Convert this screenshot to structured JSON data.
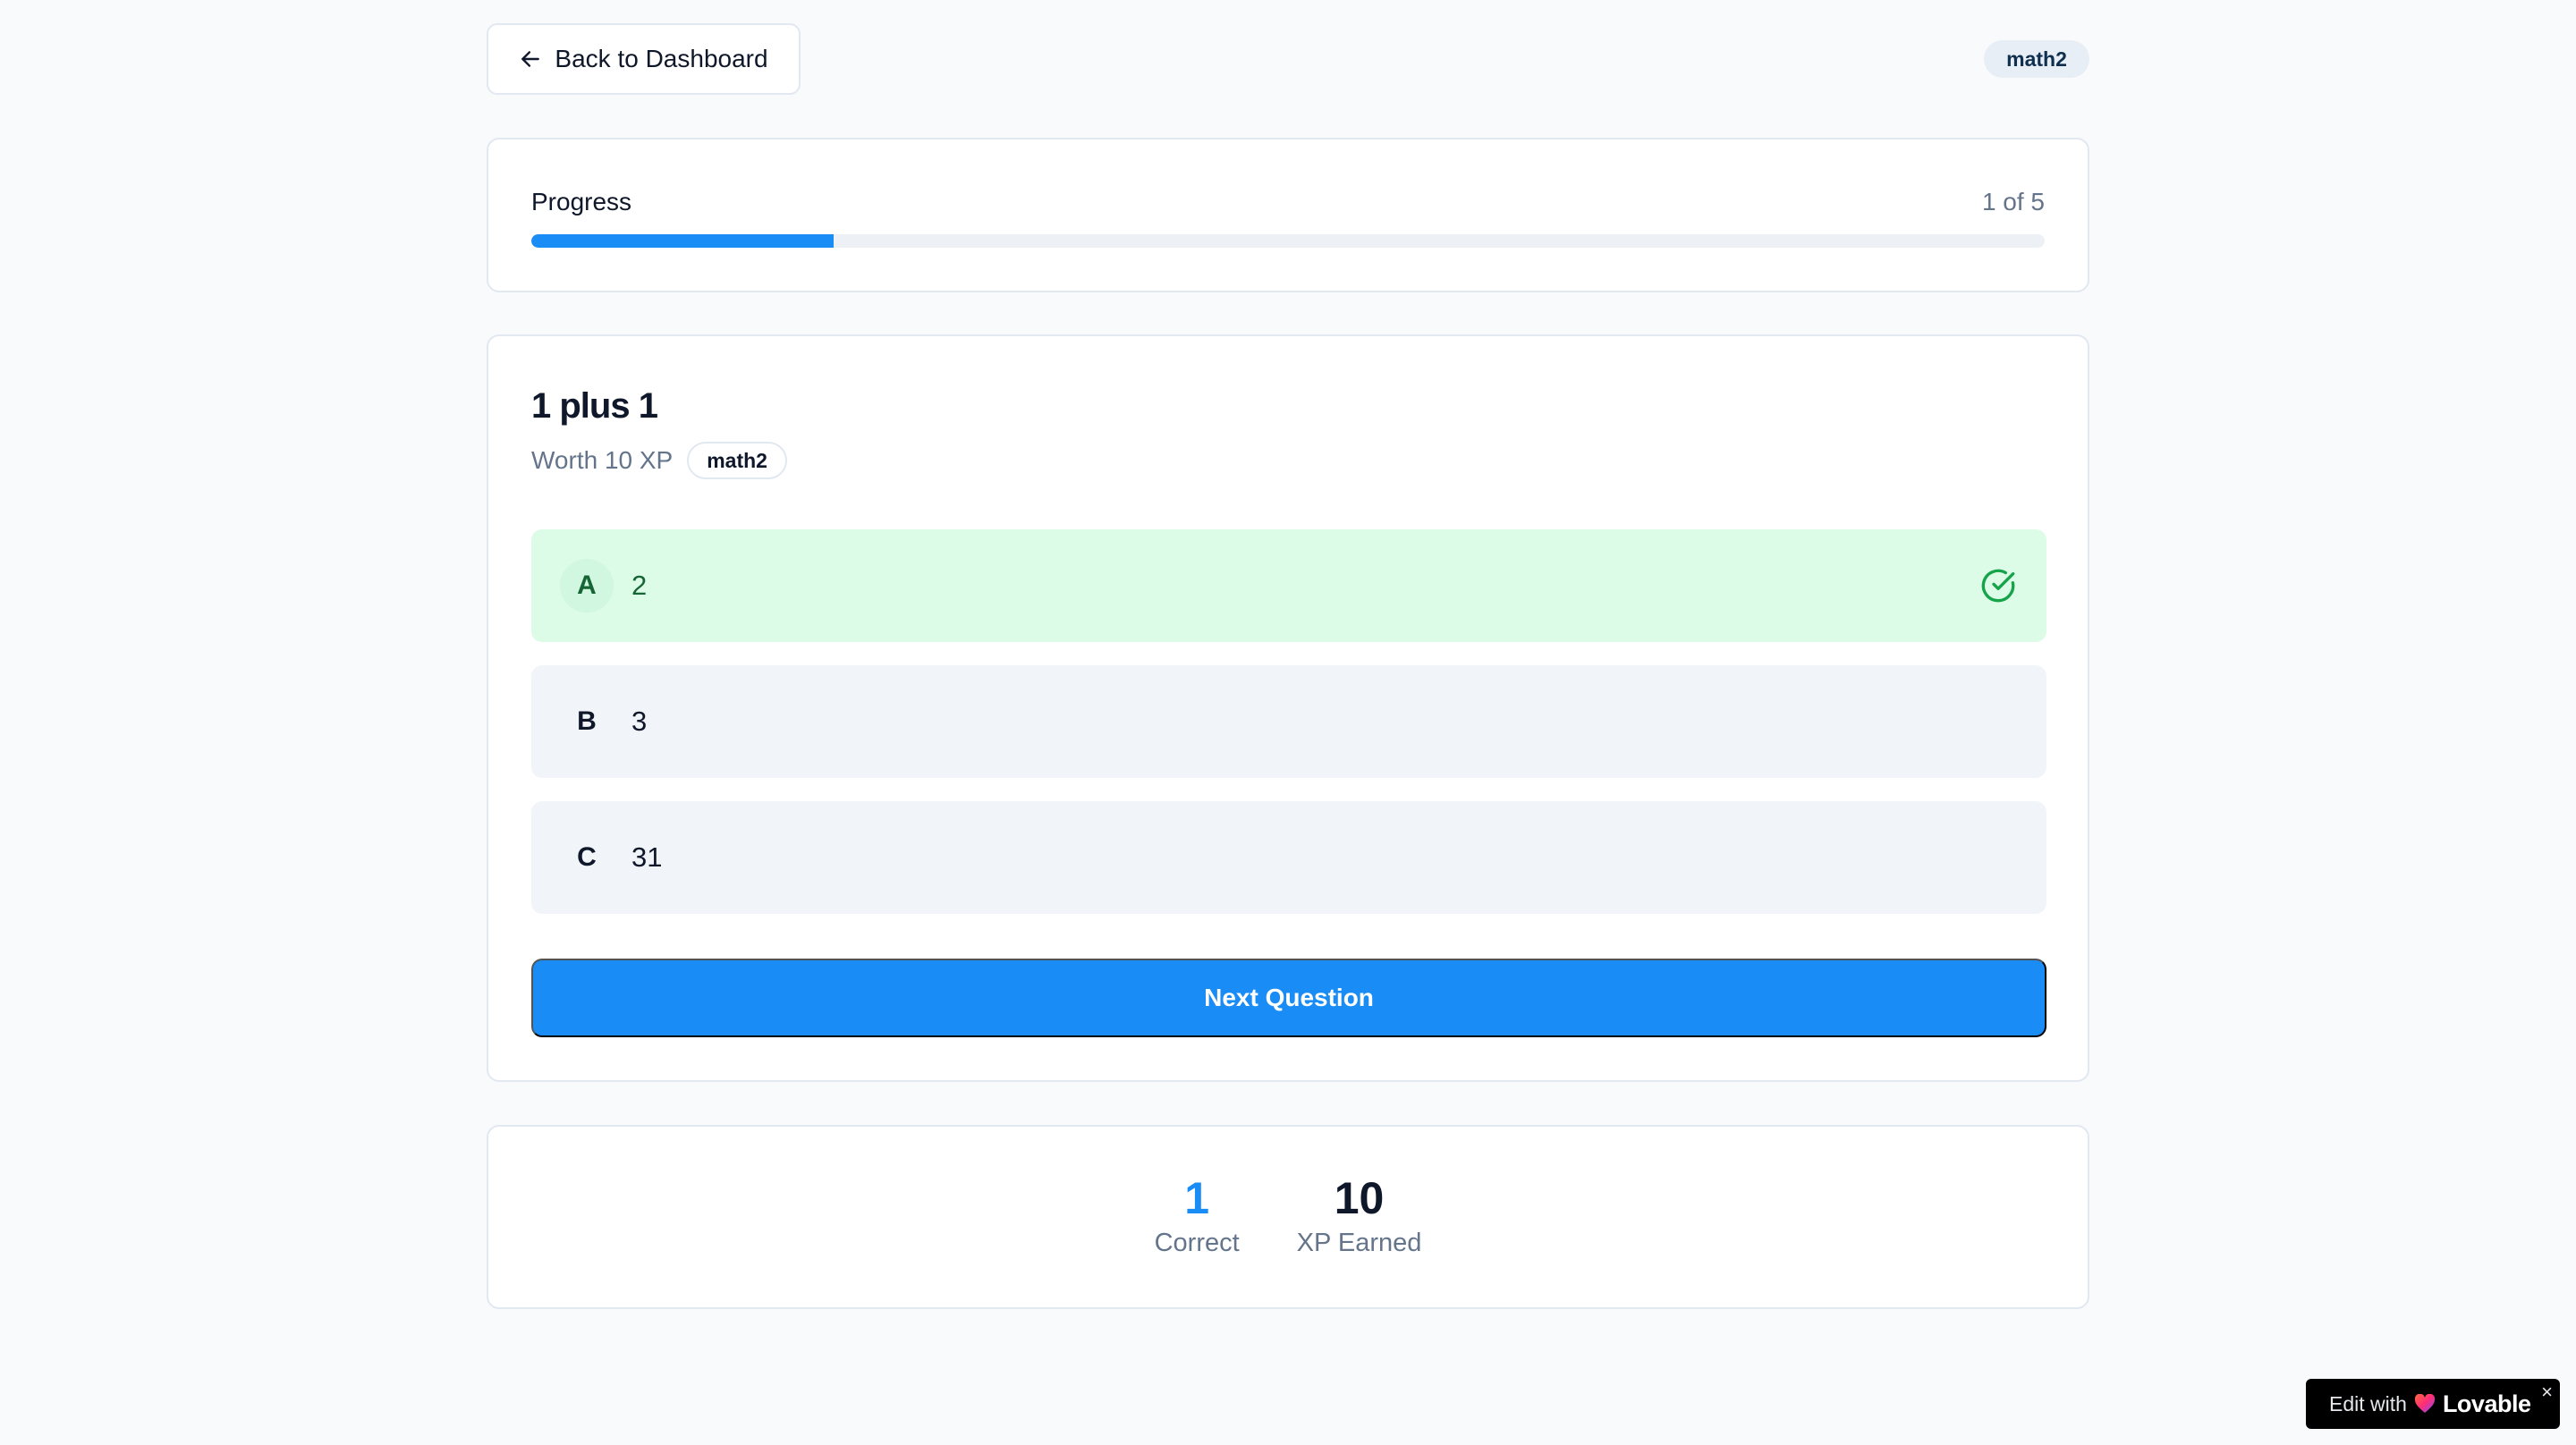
{
  "header": {
    "back_label": "Back to Dashboard",
    "topic_badge": "math2"
  },
  "progress": {
    "label": "Progress",
    "count_text": "1 of 5",
    "fraction": 0.2
  },
  "question": {
    "title": "1 plus 1",
    "worth": "Worth 10 XP",
    "tag": "math2",
    "options": [
      {
        "letter": "A",
        "text": "2",
        "state": "correct"
      },
      {
        "letter": "B",
        "text": "3",
        "state": "neutral"
      },
      {
        "letter": "C",
        "text": "31",
        "state": "neutral"
      }
    ],
    "next_label": "Next Question"
  },
  "stats": {
    "correct_value": "1",
    "correct_label": "Correct",
    "xp_value": "10",
    "xp_label": "XP Earned"
  },
  "badge": {
    "edit_with": "Edit with",
    "brand": "Lovable",
    "close": "×"
  },
  "colors": {
    "accent": "#1a8cf5",
    "correct_bg": "#dcfce7",
    "correct_text": "#166534"
  },
  "icons": {
    "back": "arrow-left-icon",
    "correct": "check-circle-icon",
    "brand": "heart-icon"
  }
}
